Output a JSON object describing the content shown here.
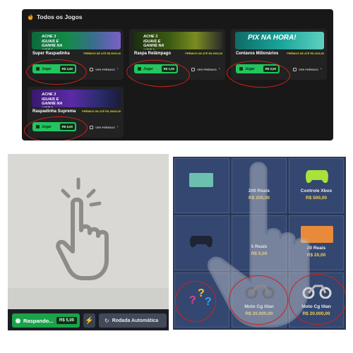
{
  "top": {
    "section_title": "Todos os Jogos",
    "cards": [
      {
        "title": "Super Raspadinha",
        "prize": "PRÊMIOS DE ATÉ R$ 5000,00",
        "play": "Jogar",
        "price": "R$ 2,50",
        "prizes_link": "VER PRÊMIOS",
        "banner": "ACHE 3 IGUAIS E GANHE NA HORA"
      },
      {
        "title": "Raspa Relâmpago",
        "prize": "PRÊMIOS DE ATÉ R$ 2500,00",
        "play": "Jogar",
        "price": "R$ 1,00",
        "prizes_link": "VER PRÊMIOS",
        "banner": "ACHE 3 IGUAIS E GANHE NA HORA"
      },
      {
        "title": "Centavos Milionários",
        "prize": "PRÊMIOS DE ATÉ R$ 1000,00",
        "play": "Jogar",
        "price": "R$ 0,50",
        "prizes_link": "VER PRÊMIOS",
        "banner": "PIX NA HORA!"
      },
      {
        "title": "Raspadinha Suprema",
        "prize": "PRÊMIOS DE ATÉ R$ 15000,00",
        "play": "Jogar",
        "price": "R$ 5,00",
        "prizes_link": "VER PRÊMIOS",
        "banner": "ACHE 3 IGUAIS E GANHE NA HORA"
      }
    ]
  },
  "bottom_left": {
    "scratch_label": "Raspando...",
    "scratch_price": "R$ 5,00",
    "bolt_icon": "⚡",
    "auto_label": "Rodada Automática"
  },
  "bottom_right": {
    "tiles": [
      {
        "label": "",
        "price": ""
      },
      {
        "label": "200 Reais",
        "price": "R$ 200,00"
      },
      {
        "label": "Controle Xbox",
        "price": "R$ 500,00"
      },
      {
        "label": "",
        "price": ""
      },
      {
        "label": "5 Reais",
        "price": "R$ 5,00"
      },
      {
        "label": "20 Reais",
        "price": "R$ 20,00"
      },
      {
        "label": "",
        "price": ""
      },
      {
        "label": "Moto Cg titan",
        "price": "R$ 20.000,00"
      },
      {
        "label": "Moto Cg titan",
        "price": "R$ 20.000,00"
      }
    ]
  },
  "colors": {
    "accent_green": "#22c55e",
    "ring_red": "#d0211c",
    "prize_yellow": "#d8d82a"
  }
}
